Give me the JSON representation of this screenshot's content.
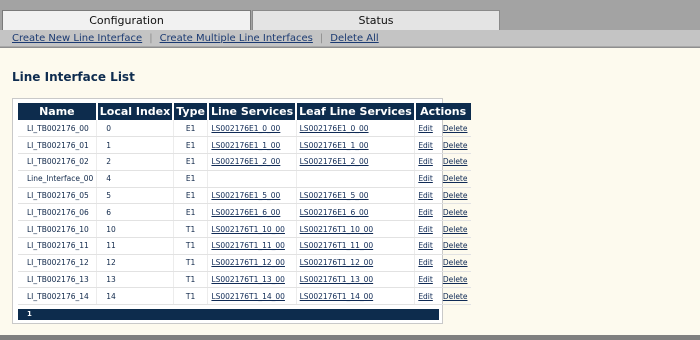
{
  "tabs": [
    {
      "label": "Configuration",
      "active": true
    },
    {
      "label": "Status",
      "active": false
    }
  ],
  "subnav": {
    "create_new": "Create New Line Interface",
    "create_multiple": "Create Multiple Line Interfaces",
    "delete_all": "Delete All",
    "separator": "|"
  },
  "page": {
    "title": "Line Interface List"
  },
  "table": {
    "headers": [
      "Name",
      "Local Index",
      "Type",
      "Line Services",
      "Leaf Line Services",
      "Actions"
    ],
    "edit_label": "Edit",
    "delete_label": "Delete",
    "rows": [
      {
        "name": "LI_TB002176_00",
        "index": "0",
        "type": "E1",
        "line": "LS002176E1_0_00",
        "leaf": "LS002176E1_0_00"
      },
      {
        "name": "LI_TB002176_01",
        "index": "1",
        "type": "E1",
        "line": "LS002176E1_1_00",
        "leaf": "LS002176E1_1_00"
      },
      {
        "name": "LI_TB002176_02",
        "index": "2",
        "type": "E1",
        "line": "LS002176E1_2_00",
        "leaf": "LS002176E1_2_00"
      },
      {
        "name": "Line_Interface_00",
        "index": "4",
        "type": "E1",
        "line": "",
        "leaf": ""
      },
      {
        "name": "LI_TB002176_05",
        "index": "5",
        "type": "E1",
        "line": "LS002176E1_5_00",
        "leaf": "LS002176E1_5_00"
      },
      {
        "name": "LI_TB002176_06",
        "index": "6",
        "type": "E1",
        "line": "LS002176E1_6_00",
        "leaf": "LS002176E1_6_00"
      },
      {
        "name": "LI_TB002176_10",
        "index": "10",
        "type": "T1",
        "line": "LS002176T1_10_00",
        "leaf": "LS002176T1_10_00"
      },
      {
        "name": "LI_TB002176_11",
        "index": "11",
        "type": "T1",
        "line": "LS002176T1_11_00",
        "leaf": "LS002176T1_11_00"
      },
      {
        "name": "LI_TB002176_12",
        "index": "12",
        "type": "T1",
        "line": "LS002176T1_12_00",
        "leaf": "LS002176T1_12_00"
      },
      {
        "name": "LI_TB002176_13",
        "index": "13",
        "type": "T1",
        "line": "LS002176T1_13_00",
        "leaf": "LS002176T1_13_00"
      },
      {
        "name": "LI_TB002176_14",
        "index": "14",
        "type": "T1",
        "line": "LS002176T1_14_00",
        "leaf": "LS002176T1_14_00"
      }
    ]
  },
  "pager": {
    "current_page": "1"
  }
}
